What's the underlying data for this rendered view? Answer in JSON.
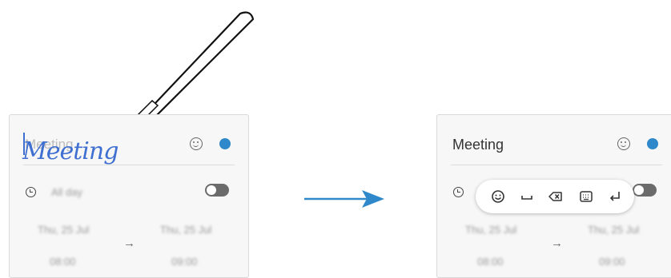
{
  "left_panel": {
    "title": "Meeting",
    "handwriting": "Meeting",
    "all_day_label": "All day",
    "start_date": "Thu, 25 Jul",
    "end_date": "Thu, 25 Jul",
    "start_time": "08:00",
    "end_time": "09:00",
    "range_arrow": "→"
  },
  "right_panel": {
    "title": "Meeting",
    "start_date": "Thu, 25 Jul",
    "end_date": "Thu, 25 Jul",
    "start_time": "08:00",
    "end_time": "09:00",
    "range_arrow": "→"
  },
  "toolbar": {
    "icons": [
      "emoji-icon",
      "space-icon",
      "backspace-icon",
      "keyboard-icon",
      "enter-icon"
    ]
  },
  "colors": {
    "accent_blue": "#2f88c9",
    "handwriting_blue": "#3f6fd0",
    "arrow_blue": "#2f88c9"
  }
}
